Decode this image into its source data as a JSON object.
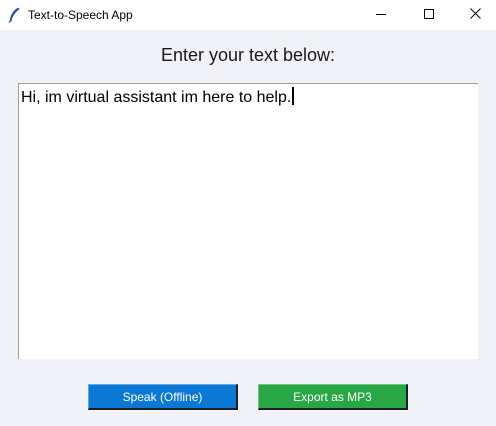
{
  "window": {
    "title": "Text-to-Speech App"
  },
  "title_bar": {
    "icon": "feather-icon",
    "controls": [
      "minimize-icon",
      "maximize-icon",
      "close-icon"
    ]
  },
  "main": {
    "prompt": "Enter your text below:",
    "text_input": {
      "value": "Hi, im virtual assistant im here to help."
    },
    "buttons": {
      "speak_label": "Speak (Offline)",
      "export_label": "Export as MP3"
    }
  },
  "colors": {
    "speak_button": "#0a78d4",
    "export_button": "#28a745",
    "window_background": "#f0f2f7"
  }
}
